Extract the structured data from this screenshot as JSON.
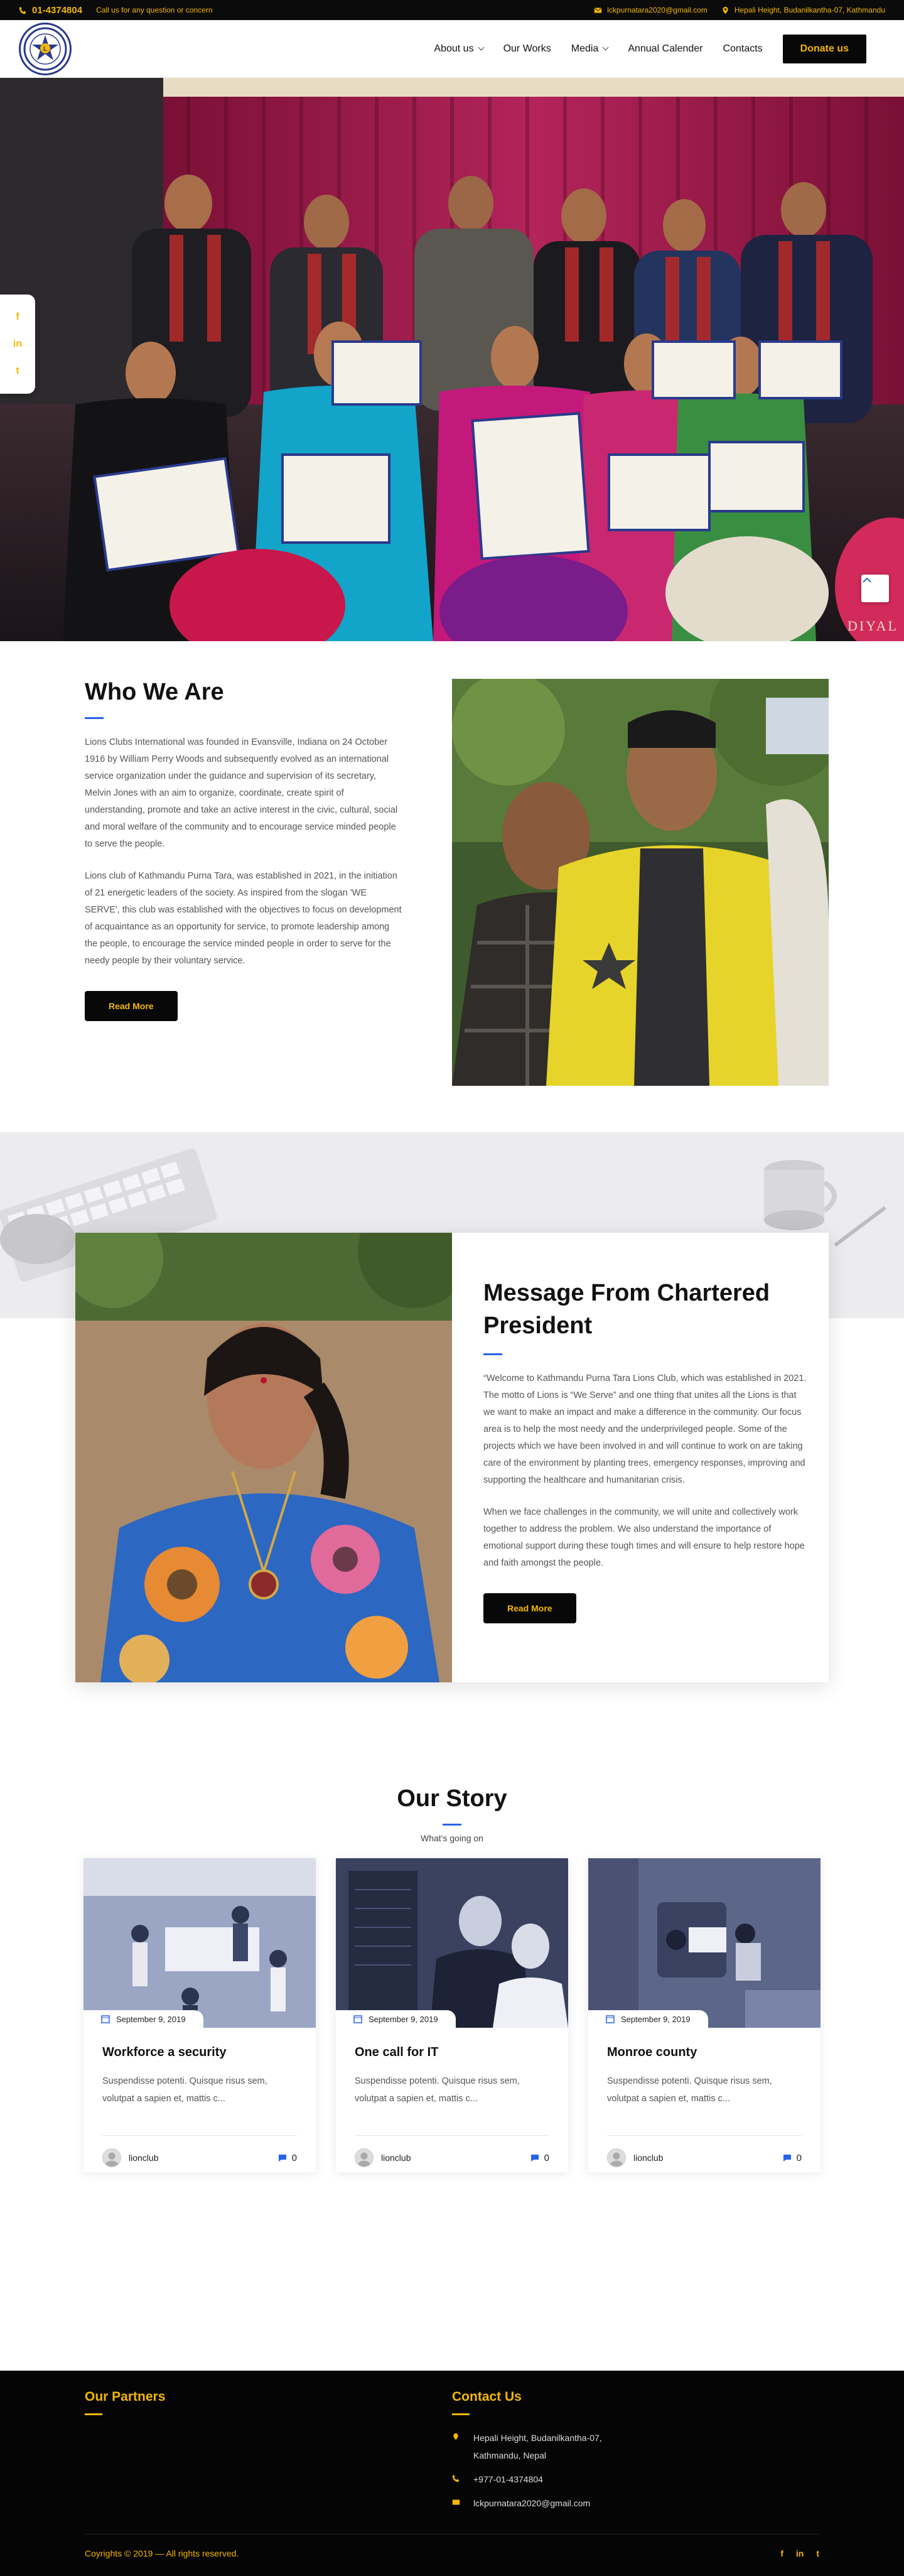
{
  "topbar": {
    "phone": "01-4374804",
    "note": "Call us for any question or concern",
    "email": "lckpurnatara2020@gmail.com",
    "address": "Hepali Height, Budanilkantha-07, Kathmandu"
  },
  "nav": {
    "items": [
      "About us",
      "Our Works",
      "Media",
      "Annual Calender",
      "Contacts"
    ],
    "donate": "Donate us"
  },
  "social_float": [
    "f",
    "in",
    "t"
  ],
  "who": {
    "title": "Who We Are",
    "para1": "Lions Clubs International was founded in Evansville, Indiana on 24 October 1916 by William Perry Woods and subsequently evolved as an international service organization under the guidance and supervision of its secretary, Melvin Jones with an aim to organize, coordinate, create spirit of understanding, promote and take an active interest in the civic, cultural, social and moral welfare of the community and to encourage service minded people to serve the people.",
    "para2": "Lions club of Kathmandu Purna Tara, was established in 2021, in the initiation of 21 energetic leaders of the society. As inspired from the slogan 'WE SERVE', this club was established with the objectives to focus on development of acquaintance as an opportunity for service, to promote leadership among the people, to encourage the service minded people in order to serve for the needy people by their voluntary service.",
    "button": "Read More"
  },
  "message": {
    "title": "Message From Chartered President",
    "para1": "“Welcome to Kathmandu Purna Tara Lions Club, which was established in 2021. The motto of Lions is “We Serve” and one thing that unites all the Lions is that we want to make an impact and make a difference in the community. Our focus area is to help the most needy and the underprivileged people. Some of the projects which we have been involved in and will continue to work on are taking care of the environment by planting trees, emergency responses, improving and supporting the healthcare and humanitarian crisis.",
    "para2": "When we face challenges in the community, we will unite and collectively work together to address the problem. We also understand the importance of emotional support during these tough times and will ensure to help restore hope and faith amongst the people.",
    "button": "Read More"
  },
  "story": {
    "title": "Our Story",
    "subtitle": "What's going on",
    "posts": [
      {
        "date": "September 9, 2019",
        "title": "Workforce a security",
        "excerpt": "Suspendisse potenti. Quisque risus sem, volutpat a sapien et, mattis c...",
        "author": "lionclub",
        "comments": "0"
      },
      {
        "date": "September 9, 2019",
        "title": "One call for IT",
        "excerpt": "Suspendisse potenti. Quisque risus sem, volutpat a sapien et, mattis c...",
        "author": "lionclub",
        "comments": "0"
      },
      {
        "date": "September 9, 2019",
        "title": "Monroe county",
        "excerpt": "Suspendisse potenti. Quisque risus sem, volutpat a sapien et, mattis c...",
        "author": "lionclub",
        "comments": "0"
      }
    ]
  },
  "footer": {
    "partners_title": "Our Partners",
    "contact_title": "Contact Us",
    "address": "Hepali Height, Budanilkantha-07, Kathmandu, Nepal",
    "phone": "+977-01-4374804",
    "email": "lckpurnatara2020@gmail.com",
    "copyright": "Coyrights © 2019 — All rights reserved.",
    "social": [
      "f",
      "in",
      "t"
    ]
  },
  "colors": {
    "accent": "#f2b705",
    "dark": "#080808",
    "blue": "#2563eb"
  },
  "icons": [
    "phone-icon",
    "mail-icon",
    "location-icon",
    "calendar-icon",
    "comment-icon",
    "chevron-up-icon"
  ]
}
